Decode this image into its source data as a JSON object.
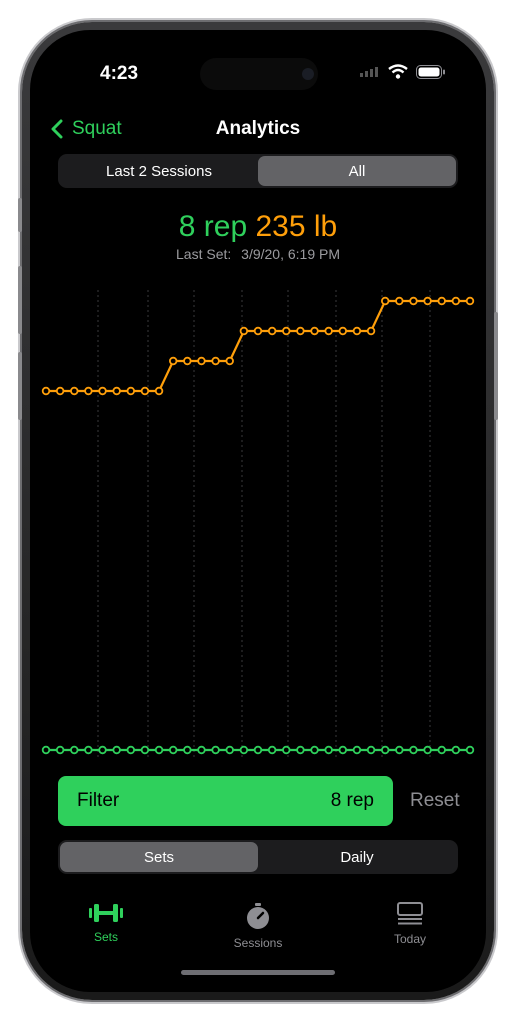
{
  "status": {
    "time": "4:23"
  },
  "nav": {
    "back_label": "Squat",
    "title": "Analytics"
  },
  "range_segment": {
    "options": [
      "Last 2 Sessions",
      "All"
    ],
    "selected": "All"
  },
  "summary": {
    "reps": "8 rep",
    "weight": "235 lb",
    "last_set_label": "Last Set:",
    "last_set_value": "3/9/20, 6:19 PM"
  },
  "chart_data": {
    "type": "line",
    "grid": true,
    "series": [
      {
        "color": "#ff9f0a",
        "values": [
          225,
          225,
          225,
          225,
          225,
          225,
          225,
          225,
          225,
          230,
          230,
          230,
          230,
          230,
          235,
          235,
          235,
          235,
          235,
          235,
          235,
          235,
          235,
          235,
          240,
          240,
          240,
          240,
          240,
          240,
          240
        ]
      },
      {
        "color": "#2fd05c",
        "values": [
          8,
          8,
          8,
          8,
          8,
          8,
          8,
          8,
          8,
          8,
          8,
          8,
          8,
          8,
          8,
          8,
          8,
          8,
          8,
          8,
          8,
          8,
          8,
          8,
          8,
          8,
          8,
          8,
          8,
          8,
          8
        ]
      }
    ]
  },
  "filter": {
    "label": "Filter",
    "value": "8 rep",
    "reset_label": "Reset"
  },
  "view_segment": {
    "options": [
      "Sets",
      "Daily"
    ],
    "selected": "Sets"
  },
  "tabbar": {
    "items": [
      {
        "label": "Sets",
        "icon": "dumbbell-icon",
        "active": true
      },
      {
        "label": "Sessions",
        "icon": "stopwatch-icon",
        "active": false
      },
      {
        "label": "Today",
        "icon": "list-icon",
        "active": false
      }
    ]
  },
  "colors": {
    "accent": "#2fd05c",
    "weight": "#ff9f0a"
  }
}
